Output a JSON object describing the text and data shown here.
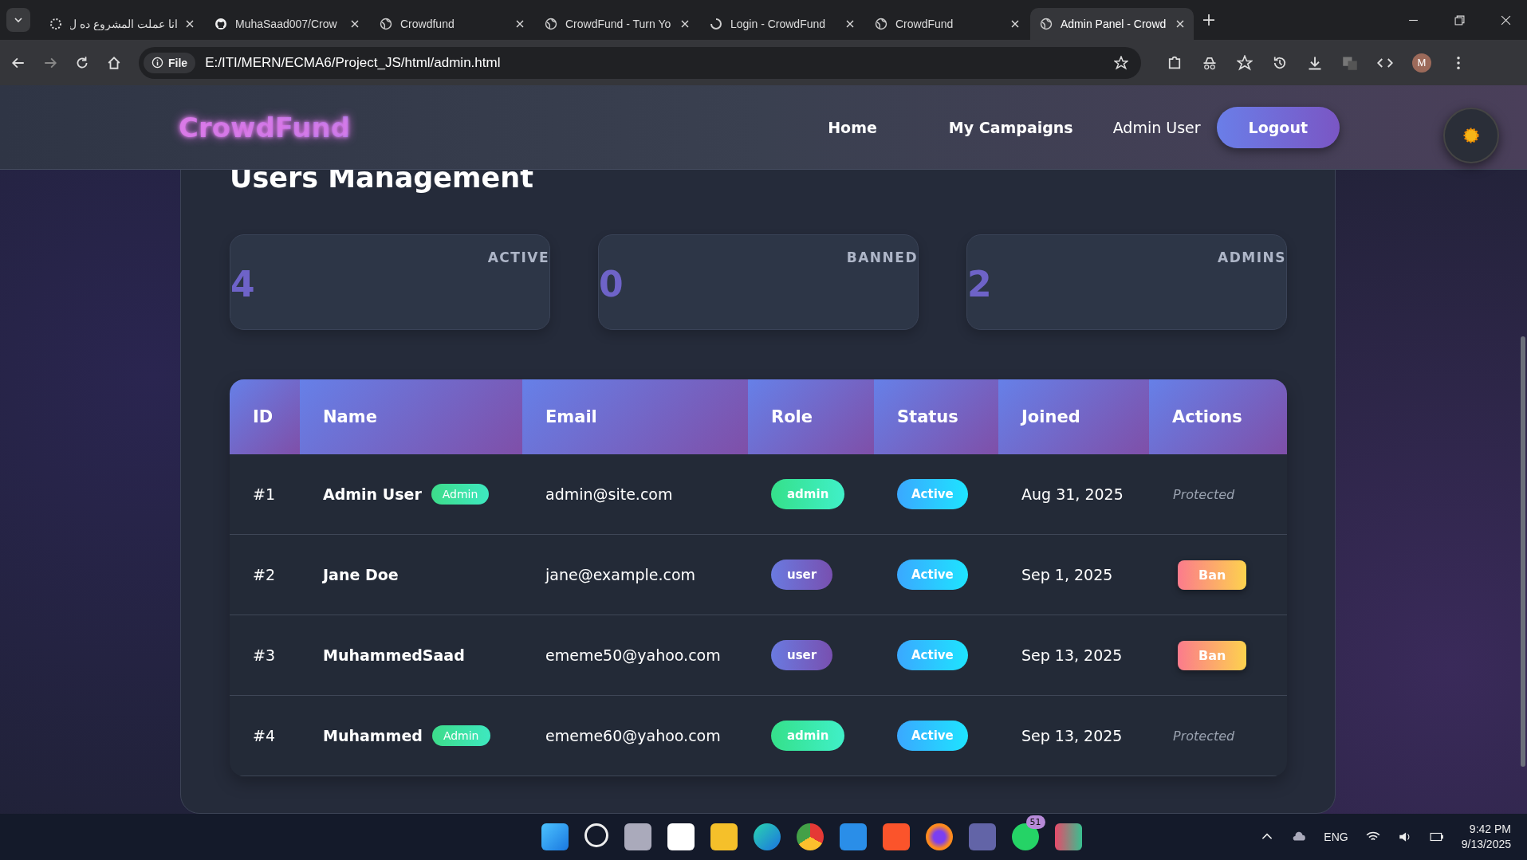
{
  "browser": {
    "tabs": [
      {
        "title": "انا عملت المشروع ده ل",
        "selected": false
      },
      {
        "title": "MuhaSaad007/Crow",
        "selected": false
      },
      {
        "title": "Crowdfund",
        "selected": false
      },
      {
        "title": "CrowdFund - Turn Yo",
        "selected": false
      },
      {
        "title": "Login - CrowdFund",
        "selected": false
      },
      {
        "title": "CrowdFund",
        "selected": false
      },
      {
        "title": "Admin Panel - Crowd",
        "selected": true
      }
    ],
    "address": {
      "scheme": "File",
      "url": "E:/ITI/MERN/ECMA6/Project_JS/html/admin.html"
    },
    "profile": "M"
  },
  "header": {
    "logo": "CrowdFund",
    "nav": [
      {
        "label": "Home",
        "kind": "link"
      },
      {
        "label": "My Campaigns",
        "kind": "link"
      },
      {
        "label": "Admin User",
        "kind": "text"
      },
      {
        "label": "Logout",
        "kind": "button"
      }
    ]
  },
  "page": {
    "title": "Users Management",
    "stats": [
      {
        "value": "4",
        "label": "ACTIVE"
      },
      {
        "value": "0",
        "label": "BANNED"
      },
      {
        "value": "2",
        "label": "ADMINS"
      }
    ],
    "table": {
      "columns": [
        "ID",
        "Name",
        "Email",
        "Role",
        "Status",
        "Joined",
        "Actions"
      ],
      "rows": [
        {
          "id": "#1",
          "name": "Admin User",
          "badge": "Admin",
          "email": "admin@site.com",
          "role": {
            "label": "admin",
            "kind": "admin"
          },
          "status": "Active",
          "joined": "Aug 31, 2025",
          "action": {
            "kind": "protected",
            "label": "Protected"
          }
        },
        {
          "id": "#2",
          "name": "Jane Doe",
          "email": "jane@example.com",
          "role": {
            "label": "user",
            "kind": "user"
          },
          "status": "Active",
          "joined": "Sep 1, 2025",
          "action": {
            "kind": "ban",
            "label": "Ban"
          }
        },
        {
          "id": "#3",
          "name": "MuhammedSaad",
          "email": "ememe50@yahoo.com",
          "role": {
            "label": "user",
            "kind": "user"
          },
          "status": "Active",
          "joined": "Sep 13, 2025",
          "action": {
            "kind": "ban",
            "label": "Ban"
          }
        },
        {
          "id": "#4",
          "name": "Muhammed",
          "badge": "Admin",
          "email": "ememe60@yahoo.com",
          "role": {
            "label": "admin",
            "kind": "admin"
          },
          "status": "Active",
          "joined": "Sep 13, 2025",
          "action": {
            "kind": "protected",
            "label": "Protected"
          }
        }
      ]
    }
  },
  "taskbar": {
    "whatsapp_badge": "51",
    "language": "ENG",
    "time": "9:42 PM",
    "date": "9/13/2025"
  }
}
